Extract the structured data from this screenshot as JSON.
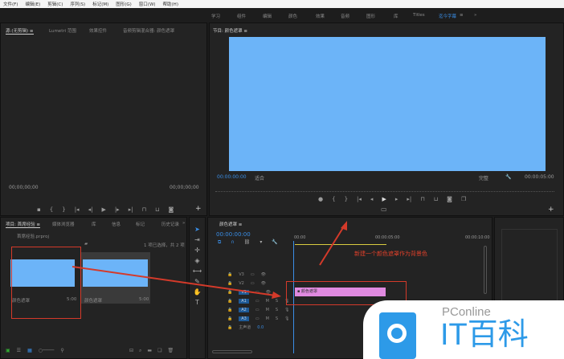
{
  "menu": [
    "文件(F)",
    "编辑(E)",
    "剪辑(C)",
    "序列(S)",
    "标记(M)",
    "图形(G)",
    "窗口(W)",
    "帮助(H)"
  ],
  "workspaces": [
    "学习",
    "组件",
    "编辑",
    "颜色",
    "效果",
    "音频",
    "图形",
    "库",
    "Titles",
    "迄今字幕",
    "≡",
    "»"
  ],
  "source": {
    "tabs": [
      "源:(无剪辑) ≡",
      "Lumetri 范围",
      "效果控件",
      "音频剪辑混合器: 颜色遮罩"
    ],
    "tc_left": "00;00;00;00",
    "tc_right": "00;00;00;00"
  },
  "program": {
    "tab": "节目: 颜色遮罩 ≡",
    "tc": "00:00:00:00",
    "fit": "适合",
    "quality": "完整",
    "duration": "00:00:05:00",
    "video_color": "#6cb4f8"
  },
  "project": {
    "tabs": [
      "项目: 首席经验 ≡",
      "媒体浏览器",
      "库",
      "信息",
      "标记",
      "历史记录",
      "»"
    ],
    "file": "首席经验.prproj",
    "selection": "1 项已选择，共 2 项",
    "items": [
      {
        "name": "颜色遮罩",
        "dur": "5:00"
      },
      {
        "name": "颜色遮罩",
        "dur": "5:00"
      }
    ]
  },
  "timeline": {
    "tab": "颜色遮罩 ≡",
    "tc": "00:00:00:00",
    "ruler": [
      "00:00",
      "00:00:05:00",
      "00:00:10:00"
    ],
    "tracks": [
      "V3",
      "V2",
      "V1",
      "A1",
      "A2",
      "A3"
    ],
    "master": "主声道",
    "master_val": "0.0",
    "clip": "颜色遮罩",
    "clip_color": "#e08ae0"
  },
  "annotation": "新建一个颜色遮罩作为背景色",
  "logo": {
    "brand": "PConline",
    "name": "IT百科"
  }
}
